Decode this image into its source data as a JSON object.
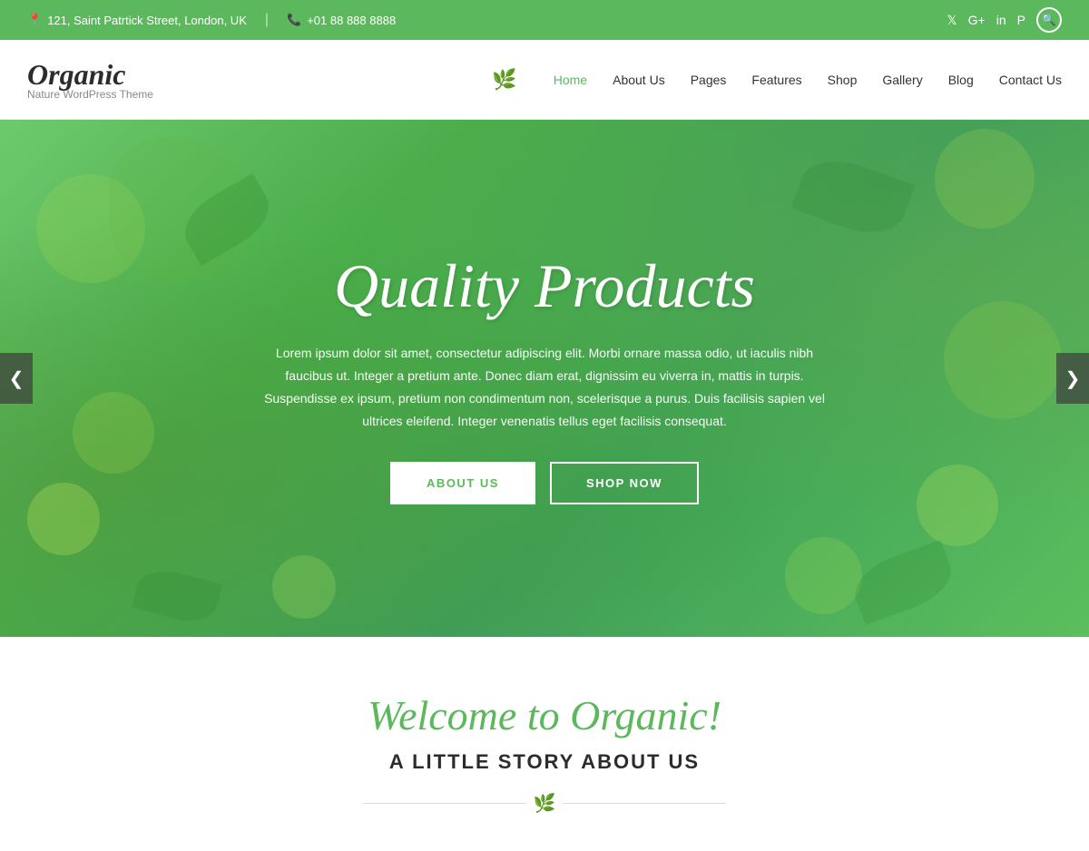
{
  "topbar": {
    "address": "121, Saint Patrtick Street, London, UK",
    "phone": "+01 88 888 8888",
    "location_icon": "📍",
    "phone_icon": "📞"
  },
  "social": {
    "twitter": "𝕏",
    "google": "G+",
    "linkedin": "in",
    "pinterest": "P",
    "search": "🔍"
  },
  "header": {
    "logo": "Organic",
    "tagline": "Nature WordPress Theme",
    "nav": [
      {
        "label": "Home",
        "active": true
      },
      {
        "label": "About Us",
        "active": false
      },
      {
        "label": "Pages",
        "active": false
      },
      {
        "label": "Features",
        "active": false
      },
      {
        "label": "Shop",
        "active": false
      },
      {
        "label": "Gallery",
        "active": false
      },
      {
        "label": "Blog",
        "active": false
      },
      {
        "label": "Contact Us",
        "active": false
      }
    ]
  },
  "hero": {
    "title": "Quality Products",
    "body": "Lorem ipsum dolor sit amet, consectetur adipiscing elit. Morbi ornare massa odio, ut iaculis nibh faucibus ut. Integer a pretium ante. Donec diam erat, dignissim eu viverra in, mattis in turpis. Suspendisse ex ipsum, pretium non condimentum non, scelerisque a purus. Duis facilisis sapien vel ultrices eleifend. Integer venenatis tellus eget facilisis consequat.",
    "btn_about": "ABOUT US",
    "btn_shop": "SHOP NOW",
    "arrow_left": "❮",
    "arrow_right": "❯"
  },
  "welcome": {
    "script_title": "Welcome to Organic!",
    "subtitle": "A LITTLE STORY ABOUT US"
  },
  "colors": {
    "green": "#5cb85c",
    "dark": "#2c2c2c",
    "topbar_bg": "#5cb85c"
  }
}
